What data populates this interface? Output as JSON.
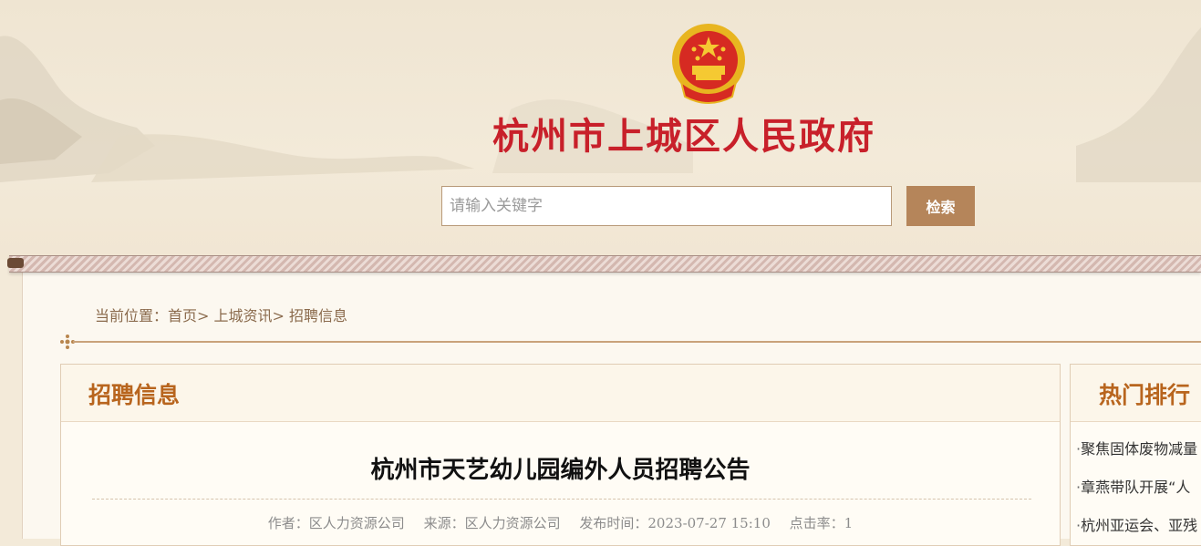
{
  "header": {
    "site_title": "杭州市上城区人民政府",
    "search_placeholder": "请输入关键字",
    "search_button_label": "检索"
  },
  "breadcrumb": {
    "prefix": "当前位置：",
    "items": [
      "首页",
      "上城资讯",
      "招聘信息"
    ],
    "separator": ">"
  },
  "main": {
    "section_title": "招聘信息",
    "article_title": "杭州市天艺幼儿园编外人员招聘公告",
    "meta": {
      "author": "作者：区人力资源公司",
      "source": "来源：区人力资源公司",
      "published": "发布时间：2023-07-27 15:10",
      "hits": "点击率：1"
    }
  },
  "sidebar": {
    "title": "热门排行",
    "items": [
      "聚焦固体废物减量",
      "章燕带队开展“人",
      "杭州亚运会、亚残"
    ]
  },
  "colors": {
    "brand_red": "#c8202a",
    "accent_brown": "#b5855a",
    "section_title": "#b8651e"
  }
}
